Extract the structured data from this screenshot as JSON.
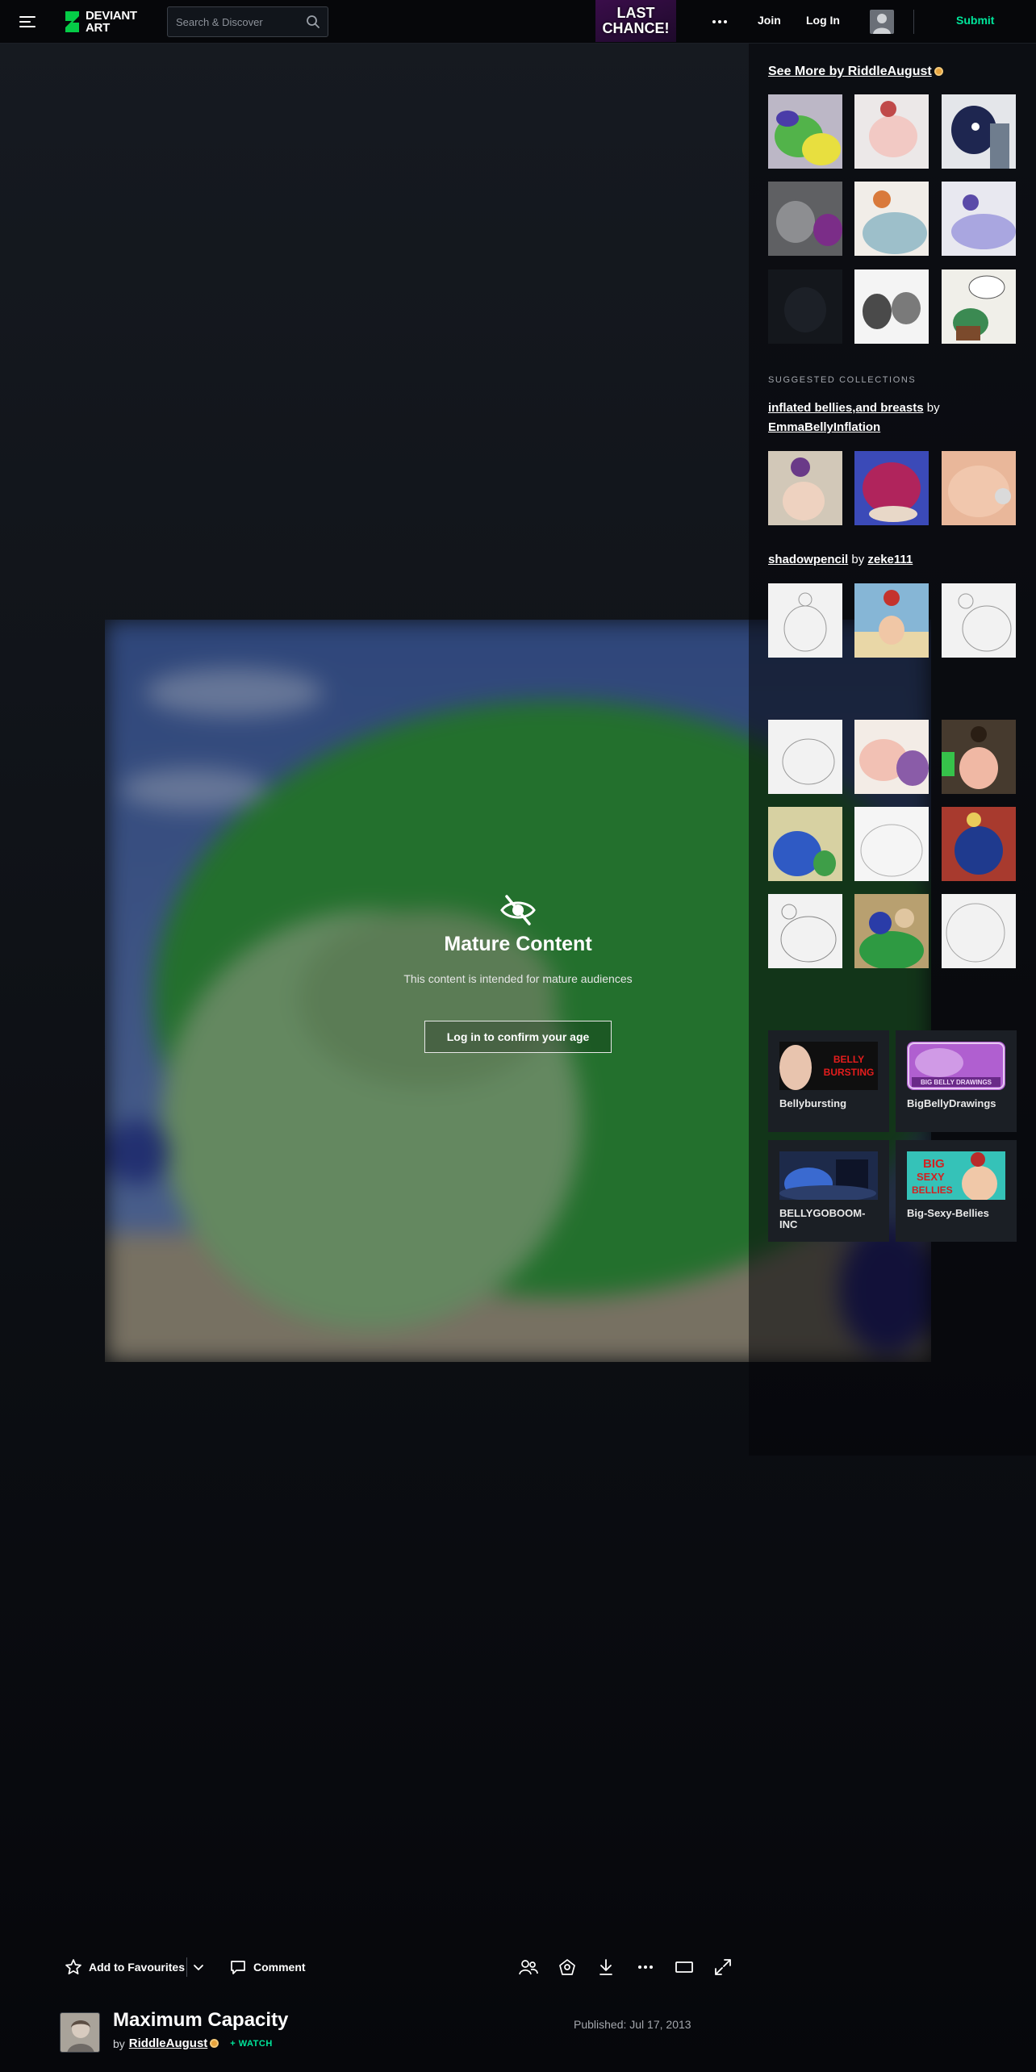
{
  "header": {
    "logo_line1": "DEVIANT",
    "logo_line2": "ART",
    "search_placeholder": "Search & Discover",
    "promo_line1": "LAST",
    "promo_line2": "CHANCE!",
    "join": "Join",
    "login": "Log In",
    "submit": "Submit"
  },
  "mature": {
    "title": "Mature Content",
    "subtitle": "This content is intended for mature audiences",
    "button": "Log in to confirm your age"
  },
  "sidebar": {
    "see_more": "See More by RiddleAugust",
    "suggested_label": "SUGGESTED COLLECTIONS",
    "collections": [
      {
        "name": "inflated bellies,and breasts",
        "by": "by",
        "author": "EmmaBellyInflation"
      },
      {
        "name": "shadowpencil",
        "by": "by",
        "author": "zeke111"
      }
    ],
    "groups": [
      {
        "name": "Bellybursting",
        "thumb_text_1": "BELLY",
        "thumb_text_2": "BURSTING"
      },
      {
        "name": "BigBellyDrawings",
        "thumb_text_1": "BIG BELLY DRAWINGS"
      },
      {
        "name": "BELLYGOBOOM-INC"
      },
      {
        "name": "Big-Sexy-Bellies",
        "thumb_text_1": "BIG",
        "thumb_text_2": "SEXY",
        "thumb_text_3": "BELLIES"
      }
    ]
  },
  "actions": {
    "favourite": "Add to Favourites",
    "comment": "Comment"
  },
  "deviation": {
    "title": "Maximum Capacity",
    "by": "by",
    "author": "RiddleAugust",
    "watch": "+ WATCH",
    "published": "Published: Jul 17, 2013"
  },
  "colors": {
    "accent": "#00e59b",
    "background": "#0f1217",
    "topbar": "#06070a",
    "card": "#1b1f25"
  }
}
